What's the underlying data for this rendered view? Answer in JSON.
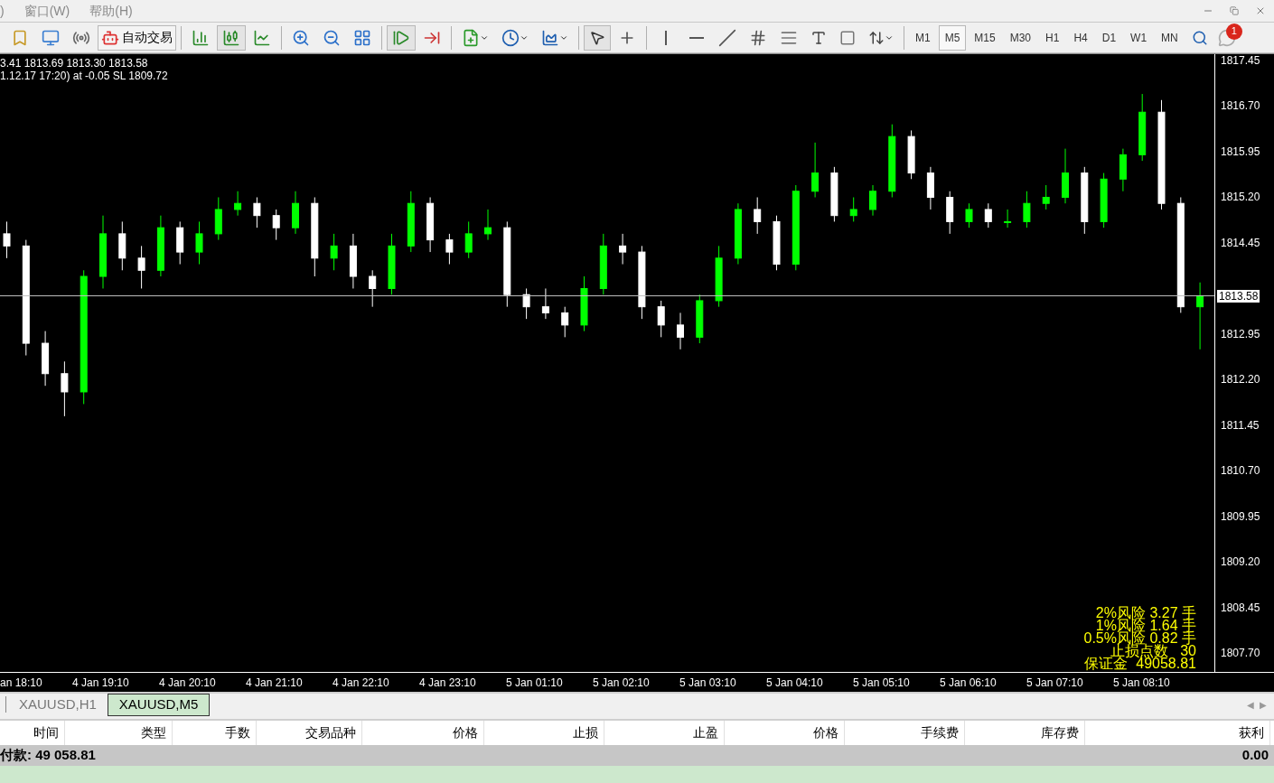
{
  "menu": [
    ")",
    "窗口(W)",
    "帮助(H)"
  ],
  "toolbar": {
    "autotrade_label": "自动交易",
    "chart_types": [
      {
        "selected": false
      },
      {
        "selected": true
      },
      {
        "selected": false
      }
    ],
    "auto_scroll": {
      "on": true
    },
    "chart_shift": {
      "on": false
    },
    "tools": [
      {
        "selected": true
      },
      {
        "selected": false
      }
    ],
    "timeframes": [
      {
        "label": "M1",
        "selected": false
      },
      {
        "label": "M5",
        "selected": true
      },
      {
        "label": "M15",
        "selected": false
      },
      {
        "label": "M30",
        "selected": false
      },
      {
        "label": "H1",
        "selected": false
      },
      {
        "label": "H4",
        "selected": false
      },
      {
        "label": "D1",
        "selected": false
      },
      {
        "label": "W1",
        "selected": false
      },
      {
        "label": "MN",
        "selected": false
      }
    ],
    "notification_count": "1"
  },
  "chart": {
    "info_lines": [
      "3.41 1813.69 1813.30 1813.58",
      "1.12.17 17:20) at -0.05 SL 1809.72"
    ],
    "time_labels": [
      "an 18:10",
      "4 Jan 19:10",
      "4 Jan 20:10",
      "4 Jan 21:10",
      "4 Jan 22:10",
      "4 Jan 23:10",
      "5 Jan 01:10",
      "5 Jan 02:10",
      "5 Jan 03:10",
      "5 Jan 04:10",
      "5 Jan 05:10",
      "5 Jan 06:10",
      "5 Jan 07:10",
      "5 Jan 08:10"
    ],
    "risk_lines": [
      "2%风险 3.27 手",
      "1%风险 1.64 手",
      "0.5%风险 0.82 手",
      "止损点数   30",
      "保证金  49058.81"
    ],
    "chart_data": {
      "type": "candlestick",
      "ylim": [
        1807.38,
        1817.554
      ],
      "yticks": [
        {
          "value": 1817.45,
          "label": "1817.45"
        },
        {
          "value": 1816.7,
          "label": "1816.70"
        },
        {
          "value": 1815.95,
          "label": "1815.95"
        },
        {
          "value": 1815.2,
          "label": "1815.20"
        },
        {
          "value": 1814.45,
          "label": "1814.45"
        },
        {
          "value": 1812.95,
          "label": "1812.95"
        },
        {
          "value": 1812.2,
          "label": "1812.20"
        },
        {
          "value": 1811.45,
          "label": "1811.45"
        },
        {
          "value": 1810.7,
          "label": "1810.70"
        },
        {
          "value": 1809.95,
          "label": "1809.95"
        },
        {
          "value": 1809.2,
          "label": "1809.20"
        },
        {
          "value": 1808.45,
          "label": "1808.45"
        },
        {
          "value": 1807.7,
          "label": "1807.70"
        }
      ],
      "ref_lines": [
        {
          "axis": "y",
          "value": 1813.58,
          "label": "1813.58"
        }
      ],
      "categories": [
        null,
        null,
        null,
        null,
        null,
        null,
        null,
        null,
        null,
        null,
        null,
        null,
        null,
        null,
        null,
        null,
        null,
        null,
        null,
        null,
        null,
        null,
        null,
        null,
        null,
        null,
        null,
        null,
        null,
        null,
        null,
        null,
        null,
        null,
        null,
        null,
        null,
        null,
        null,
        null,
        null,
        null,
        null,
        null,
        null,
        null,
        null,
        null,
        null,
        null,
        null,
        null,
        null,
        null,
        null,
        null,
        null,
        null,
        null,
        null,
        null,
        null,
        null
      ],
      "ohlc": [
        [
          1814.6,
          1814.8,
          1814.2,
          1814.4
        ],
        [
          1814.4,
          1814.5,
          1812.6,
          1812.8
        ],
        [
          1812.8,
          1813.0,
          1812.1,
          1812.3
        ],
        [
          1812.3,
          1812.5,
          1811.6,
          1812.0
        ],
        [
          1812.0,
          1814.0,
          1811.8,
          1813.9
        ],
        [
          1813.9,
          1814.9,
          1813.7,
          1814.6
        ],
        [
          1814.6,
          1814.8,
          1814.0,
          1814.2
        ],
        [
          1814.2,
          1814.4,
          1813.7,
          1814.0
        ],
        [
          1814.0,
          1814.9,
          1813.9,
          1814.7
        ],
        [
          1814.7,
          1814.8,
          1814.1,
          1814.3
        ],
        [
          1814.3,
          1814.8,
          1814.1,
          1814.6
        ],
        [
          1814.6,
          1815.2,
          1814.5,
          1815.0
        ],
        [
          1815.0,
          1815.3,
          1814.9,
          1815.1
        ],
        [
          1815.1,
          1815.2,
          1814.7,
          1814.9
        ],
        [
          1814.9,
          1815.0,
          1814.5,
          1814.7
        ],
        [
          1814.7,
          1815.3,
          1814.6,
          1815.1
        ],
        [
          1815.1,
          1815.2,
          1813.9,
          1814.2
        ],
        [
          1814.2,
          1814.6,
          1814.0,
          1814.4
        ],
        [
          1814.4,
          1814.6,
          1813.7,
          1813.9
        ],
        [
          1813.9,
          1814.0,
          1813.4,
          1813.7
        ],
        [
          1813.7,
          1814.6,
          1813.6,
          1814.4
        ],
        [
          1814.4,
          1815.3,
          1814.3,
          1815.1
        ],
        [
          1815.1,
          1815.2,
          1814.3,
          1814.5
        ],
        [
          1814.5,
          1814.6,
          1814.1,
          1814.3
        ],
        [
          1814.3,
          1814.8,
          1814.2,
          1814.6
        ],
        [
          1814.6,
          1815.0,
          1814.5,
          1814.7
        ],
        [
          1814.7,
          1814.8,
          1813.4,
          1813.6
        ],
        [
          1813.6,
          1813.7,
          1813.2,
          1813.4
        ],
        [
          1813.4,
          1813.7,
          1813.2,
          1813.3
        ],
        [
          1813.3,
          1813.4,
          1812.9,
          1813.1
        ],
        [
          1813.1,
          1813.9,
          1813.0,
          1813.7
        ],
        [
          1813.7,
          1814.6,
          1813.6,
          1814.4
        ],
        [
          1814.4,
          1814.6,
          1814.1,
          1814.3
        ],
        [
          1814.3,
          1814.4,
          1813.2,
          1813.4
        ],
        [
          1813.4,
          1813.5,
          1812.9,
          1813.1
        ],
        [
          1813.1,
          1813.3,
          1812.7,
          1812.9
        ],
        [
          1812.9,
          1813.6,
          1812.8,
          1813.5
        ],
        [
          1813.5,
          1814.4,
          1813.4,
          1814.2
        ],
        [
          1814.2,
          1815.1,
          1814.1,
          1815.0
        ],
        [
          1815.0,
          1815.2,
          1814.6,
          1814.8
        ],
        [
          1814.8,
          1814.9,
          1814.0,
          1814.1
        ],
        [
          1814.1,
          1815.4,
          1814.0,
          1815.3
        ],
        [
          1815.3,
          1816.1,
          1815.2,
          1815.6
        ],
        [
          1815.6,
          1815.7,
          1814.8,
          1814.9
        ],
        [
          1814.9,
          1815.2,
          1814.8,
          1815.0
        ],
        [
          1815.0,
          1815.4,
          1814.9,
          1815.3
        ],
        [
          1815.3,
          1816.4,
          1815.2,
          1816.2
        ],
        [
          1816.2,
          1816.3,
          1815.5,
          1815.6
        ],
        [
          1815.6,
          1815.7,
          1815.0,
          1815.2
        ],
        [
          1815.2,
          1815.3,
          1814.6,
          1814.8
        ],
        [
          1814.8,
          1815.1,
          1814.7,
          1815.0
        ],
        [
          1815.0,
          1815.1,
          1814.7,
          1814.8
        ],
        [
          1814.8,
          1815.0,
          1814.7,
          1814.8
        ],
        [
          1814.8,
          1815.3,
          1814.7,
          1815.1
        ],
        [
          1815.1,
          1815.4,
          1815.0,
          1815.2
        ],
        [
          1815.2,
          1816.0,
          1815.1,
          1815.6
        ],
        [
          1815.6,
          1815.7,
          1814.6,
          1814.8
        ],
        [
          1814.8,
          1815.6,
          1814.7,
          1815.5
        ],
        [
          1815.5,
          1816.0,
          1815.3,
          1815.9
        ],
        [
          1815.9,
          1816.9,
          1815.8,
          1816.6
        ],
        [
          1816.6,
          1816.8,
          1815.0,
          1815.1
        ],
        [
          1815.1,
          1815.2,
          1813.3,
          1813.4
        ],
        [
          1813.4,
          1813.8,
          1812.7,
          1813.58
        ]
      ]
    }
  },
  "chart_tabs": [
    {
      "label": "XAUUSD,H1",
      "selected": false
    },
    {
      "label": "XAUUSD,M5",
      "selected": true
    }
  ],
  "tab_scroll": [
    "◀",
    "▶"
  ],
  "table": {
    "columns": [
      "时间",
      "类型",
      "手数",
      "交易品种",
      "价格",
      "止损",
      "止盈",
      "价格",
      "手续费",
      "库存费",
      "获利"
    ],
    "summary": {
      "text": "付款: 49 058.81",
      "profit": "0.00"
    }
  }
}
